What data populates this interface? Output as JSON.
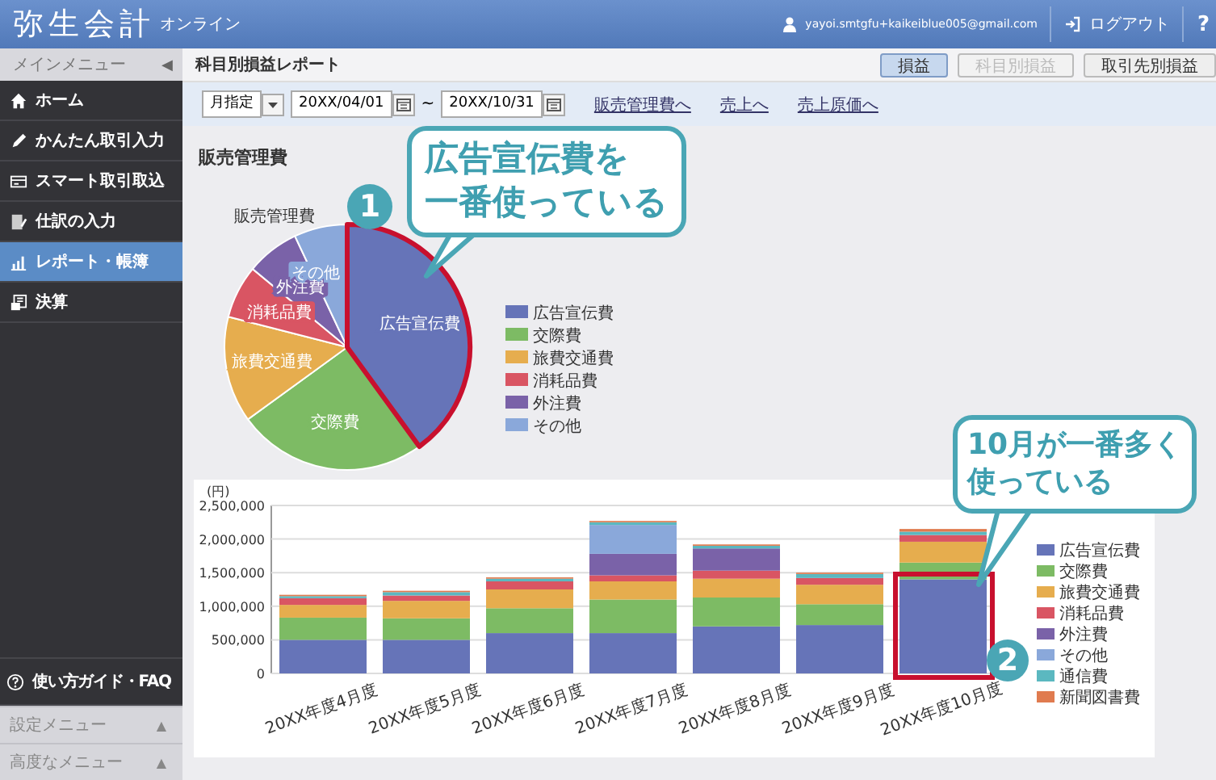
{
  "header": {
    "app_name": "弥生会計",
    "app_suffix": "オンライン",
    "user": "yayoi.smtgfu+kaikeiblue005@gmail.com",
    "logout": "ログアウト",
    "help": "?"
  },
  "sidebar": {
    "title": "メインメニュー",
    "collapse": "◀",
    "items": [
      {
        "label": "ホーム",
        "kind": "home",
        "selected": false
      },
      {
        "label": "かんたん取引入力",
        "kind": "pencil",
        "selected": false
      },
      {
        "label": "スマート取引取込",
        "kind": "card",
        "selected": false
      },
      {
        "label": "仕訳の入力",
        "kind": "document",
        "selected": false
      },
      {
        "label": "レポート・帳簿",
        "kind": "chart",
        "selected": true
      },
      {
        "label": "決算",
        "kind": "ledger",
        "selected": false
      }
    ],
    "help": "使い方ガイド・FAQ",
    "sections": [
      {
        "label": "設定メニュー",
        "arrow": "▲"
      },
      {
        "label": "高度なメニュー",
        "arrow": "▲"
      }
    ]
  },
  "toolbar": {
    "title": "科目別損益レポート",
    "buttons": [
      {
        "label": "損益",
        "selected": true,
        "disabled": false
      },
      {
        "label": "科目別損益",
        "selected": false,
        "disabled": true
      },
      {
        "label": "取引先別損益",
        "selected": false,
        "disabled": false
      }
    ]
  },
  "filter": {
    "mode": "月指定",
    "start": "20XX/04/01",
    "separator": "~",
    "end": "20XX/10/31",
    "links": [
      "販売管理費へ",
      "売上へ",
      "売上原価へ"
    ]
  },
  "section_title": "販売管理費",
  "pie": {
    "title": "販売管理費",
    "slices": [
      {
        "label": "広告宣伝費",
        "color": "#6674b8"
      },
      {
        "label": "交際費",
        "color": "#7dbb64"
      },
      {
        "label": "旅費交通費",
        "color": "#e6ad4e"
      },
      {
        "label": "消耗品費",
        "color": "#d95563"
      },
      {
        "label": "外注費",
        "color": "#7a62a8"
      },
      {
        "label": "その他",
        "color": "#8aa8da"
      }
    ],
    "legend": [
      {
        "label": "広告宣伝費",
        "color": "#6674b8"
      },
      {
        "label": "交際費",
        "color": "#7dbb64"
      },
      {
        "label": "旅費交通費",
        "color": "#e6ad4e"
      },
      {
        "label": "消耗品費",
        "color": "#d95563"
      },
      {
        "label": "外注費",
        "color": "#7a62a8"
      },
      {
        "label": "その他",
        "color": "#8aa8da"
      }
    ]
  },
  "bar_chart": {
    "chart_data": {
      "type": "bar",
      "ylabel": "(円)",
      "stacked": true,
      "categories": [
        "20XX年度4月度",
        "20XX年度5月度",
        "20XX年度6月度",
        "20XX年度7月度",
        "20XX年度8月度",
        "20XX年度9月度",
        "20XX年度10月度"
      ],
      "series": [
        {
          "name": "広告宣伝費",
          "color": "#6674b8",
          "values": [
            500000,
            500000,
            600000,
            600000,
            700000,
            720000,
            1400000
          ]
        },
        {
          "name": "交際費",
          "color": "#7dbb64",
          "values": [
            330000,
            320000,
            370000,
            500000,
            430000,
            310000,
            250000
          ]
        },
        {
          "name": "旅費交通費",
          "color": "#e6ad4e",
          "values": [
            190000,
            260000,
            280000,
            270000,
            280000,
            290000,
            310000
          ]
        },
        {
          "name": "消耗品費",
          "color": "#d95563",
          "values": [
            100000,
            80000,
            120000,
            90000,
            120000,
            100000,
            100000
          ]
        },
        {
          "name": "外注費",
          "color": "#7a62a8",
          "values": [
            0,
            0,
            0,
            320000,
            330000,
            0,
            0
          ]
        },
        {
          "name": "その他",
          "color": "#8aa8da",
          "values": [
            0,
            0,
            0,
            430000,
            0,
            0,
            0
          ]
        },
        {
          "name": "通信費",
          "color": "#5bb8c0",
          "values": [
            30000,
            50000,
            40000,
            40000,
            40000,
            60000,
            50000
          ]
        },
        {
          "name": "新聞図書費",
          "color": "#e07b4f",
          "values": [
            20000,
            20000,
            20000,
            20000,
            20000,
            20000,
            40000
          ]
        }
      ],
      "ylim": [
        0,
        2500000
      ],
      "grid": true,
      "legend": "right",
      "yticks": [
        {
          "value": 0,
          "label": "0"
        },
        {
          "value": 500000,
          "label": "500,000"
        },
        {
          "value": 1000000,
          "label": "1,000,000"
        },
        {
          "value": 1500000,
          "label": "1,500,000"
        },
        {
          "value": 2000000,
          "label": "2,000,000"
        },
        {
          "value": 2500000,
          "label": "2,500,000"
        }
      ]
    }
  },
  "annotations": [
    {
      "badge": "1",
      "lines": [
        "広告宣伝費を",
        "一番使っている"
      ]
    },
    {
      "badge": "2",
      "lines": [
        "10月が一番多く",
        "使っている"
      ]
    }
  ]
}
